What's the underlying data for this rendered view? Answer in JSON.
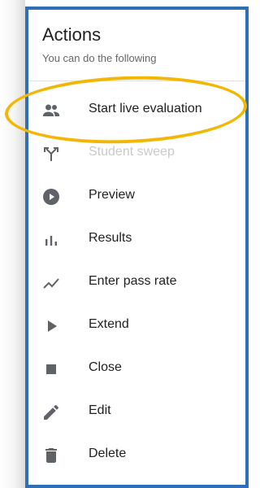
{
  "panel": {
    "title": "Actions",
    "subtitle": "You can do the following"
  },
  "items": [
    {
      "label": "Start live evaluation",
      "icon": "people-icon",
      "disabled": false
    },
    {
      "label": "Student sweep",
      "icon": "merge-arrow-icon",
      "disabled": true
    },
    {
      "label": "Preview",
      "icon": "play-circle-icon",
      "disabled": false
    },
    {
      "label": "Results",
      "icon": "bar-chart-icon",
      "disabled": false
    },
    {
      "label": "Enter pass rate",
      "icon": "trend-line-icon",
      "disabled": false
    },
    {
      "label": "Extend",
      "icon": "play-arrow-icon",
      "disabled": false
    },
    {
      "label": "Close",
      "icon": "stop-square-icon",
      "disabled": false
    },
    {
      "label": "Edit",
      "icon": "pencil-icon",
      "disabled": false
    },
    {
      "label": "Delete",
      "icon": "trash-icon",
      "disabled": false
    }
  ],
  "colors": {
    "frame": "#2f6fb8",
    "highlight": "#f2b705",
    "icon": "#5f6368",
    "disabled": "#c9c9c9"
  }
}
